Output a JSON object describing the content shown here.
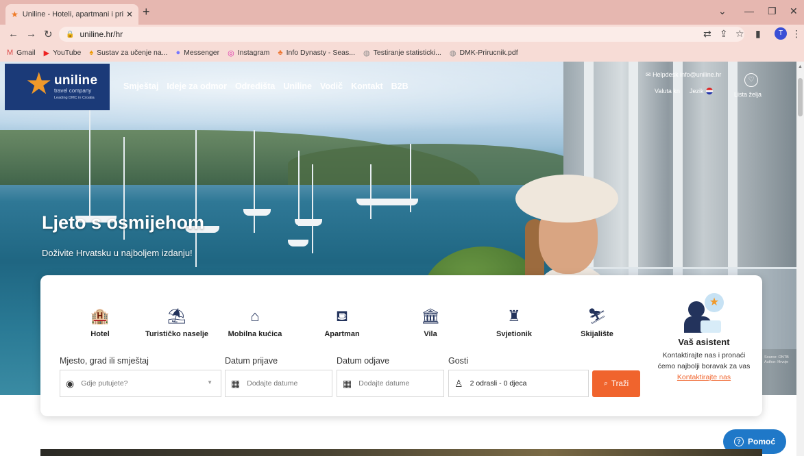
{
  "browser": {
    "tab_title": "Uniline - Hoteli, apartmani i priv",
    "tab_close": "✕",
    "new_tab": "+",
    "url": "uniline.hr/hr",
    "profile_initial": "T",
    "bookmarks": [
      {
        "icon": "gmail-icon",
        "label": "Gmail"
      },
      {
        "icon": "youtube-icon",
        "label": "YouTube"
      },
      {
        "icon": "sustav-icon",
        "label": "Sustav za učenje na..."
      },
      {
        "icon": "messenger-icon",
        "label": "Messenger"
      },
      {
        "icon": "instagram-icon",
        "label": "Instagram"
      },
      {
        "icon": "infodynasty-icon",
        "label": "Info Dynasty - Seas..."
      },
      {
        "icon": "globe-icon",
        "label": "Testiranje statisticki..."
      },
      {
        "icon": "globe-icon",
        "label": "DMK-Prirucnik.pdf"
      }
    ]
  },
  "site": {
    "logo": {
      "brand": "uniline",
      "tagline": "travel company",
      "small": "Leading DMC in Croatia"
    },
    "nav": [
      "Smještaj",
      "Ideje za odmor",
      "Odredišta",
      "Uniline",
      "Vodič",
      "Kontakt",
      "B2B"
    ],
    "helpdesk": "Helpdesk info@uniline.hr",
    "valuta": "Valuta kn",
    "jezik": "Jezik",
    "wishlist": "Lista želja"
  },
  "hero": {
    "title": "Ljeto s osmijehom",
    "subtitle": "Doživite Hrvatsku u najboljem izdanju!",
    "watermark": [
      "Source: ONTB",
      "Author: Hrvoje"
    ]
  },
  "search": {
    "types": [
      {
        "icon": "hotel-icon",
        "label": "Hotel"
      },
      {
        "icon": "tourist-resort-icon",
        "label": "Turističko naselje"
      },
      {
        "icon": "mobile-home-icon",
        "label": "Mobilna kućica"
      },
      {
        "icon": "apartment-icon",
        "label": "Apartman"
      },
      {
        "icon": "villa-icon",
        "label": "Vila"
      },
      {
        "icon": "lighthouse-icon",
        "label": "Svjetionik"
      },
      {
        "icon": "ski-resort-icon",
        "label": "Skijalište"
      }
    ],
    "place_label": "Mjesto, grad ili smještaj",
    "place_placeholder": "Gdje putujete?",
    "checkin_label": "Datum prijave",
    "checkin_placeholder": "Dodajte datume",
    "checkout_label": "Datum odjave",
    "checkout_placeholder": "Dodajte datume",
    "guests_label": "Gosti",
    "guests_value": "2 odrasli - 0 djeca",
    "button": "Traži"
  },
  "assistant": {
    "title": "Vaš asistent",
    "desc": "Kontaktirajte nas i pronaći ćemo najbolji boravak za vas",
    "link": "Kontaktirajte nas"
  },
  "help_button": "Pomoć",
  "colors": {
    "brand_navy": "#1b3a78",
    "accent_orange": "#f0642d",
    "help_blue": "#1f78c8"
  }
}
